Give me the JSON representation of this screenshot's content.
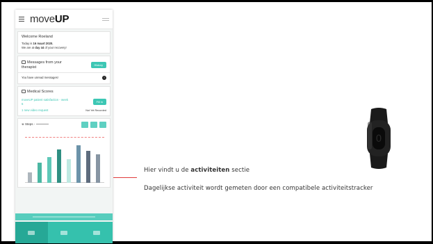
{
  "slide": {
    "caption_line1": {
      "before": "Hier vindt u de ",
      "bold": "activiteiten",
      "after": " sectie"
    },
    "caption_line2": "Dagelijkse activiteit wordt gemeten door een compatibele activiteitstracker",
    "pointer_color": "#e03b3b"
  },
  "app": {
    "logo_light": "move",
    "logo_bold": "UP",
    "accent_color": "#3dc7b4",
    "welcome": {
      "title": "Welcome Roeland",
      "today_prefix": "Today is ",
      "today_date": "16 maart 2020.",
      "recovery_prefix": "We are at ",
      "recovery_day": "day 44",
      "recovery_suffix": " of your recovery!"
    },
    "messages": {
      "title": "Messages from your therapist",
      "history_button": "History",
      "unread_text": "You have unread messages!",
      "unread_badge": "!"
    },
    "medical_scores": {
      "title": "Medical Scores",
      "survey_link": "moveUP patient satisfaction - week 6",
      "fill_button": "Fill in",
      "video_request": "1 new video request",
      "status": "Not Yet Recorded"
    },
    "steps": {
      "label": "Steps -",
      "bars": [
        {
          "value": 0.22,
          "color": "#aeb6bd"
        },
        {
          "value": 0.42,
          "color": "#4bb7a3"
        },
        {
          "value": 0.55,
          "color": "#5fc8b8"
        },
        {
          "value": 0.7,
          "color": "#2f8f82"
        },
        {
          "value": 0.5,
          "color": "#bfe9e2"
        },
        {
          "value": 0.8,
          "color": "#6c93a9"
        },
        {
          "value": 0.68,
          "color": "#5e6c7d"
        },
        {
          "value": 0.6,
          "color": "#8795a3"
        }
      ]
    }
  }
}
